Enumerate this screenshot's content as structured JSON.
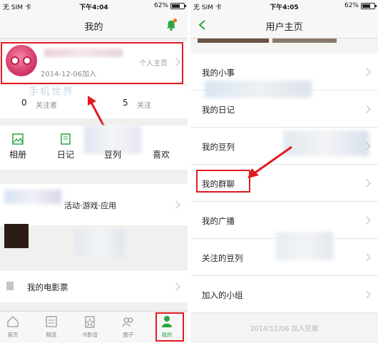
{
  "left": {
    "status": {
      "carrier": "无 SIM 卡",
      "time": "下午4:04",
      "battery": "62%"
    },
    "nav": {
      "title": "我的"
    },
    "profile": {
      "join_date": "2014-12-06加入",
      "homepage_link": "个人主页"
    },
    "watermark": "手机世界",
    "stats": {
      "followers_count": "0",
      "followers_label": "关注者",
      "following_count": "5",
      "following_label": "关注"
    },
    "grid": [
      "相册",
      "日记",
      "豆列",
      "喜欢"
    ],
    "activity_row": "活动·游戏·应用",
    "tickets_row": "我的电影票",
    "tabs": [
      {
        "label": "首页",
        "icon": "home-icon"
      },
      {
        "label": "精选",
        "icon": "featured-icon"
      },
      {
        "label": "书影音",
        "icon": "media-icon"
      },
      {
        "label": "圈子",
        "icon": "group-icon"
      },
      {
        "label": "我的",
        "icon": "user-icon"
      }
    ],
    "accent": "#2aa640",
    "highlight_color": "#e01c22"
  },
  "right": {
    "status": {
      "carrier": "无 SIM 卡",
      "time": "下午4:05",
      "battery": "62%"
    },
    "nav": {
      "title": "用户主页"
    },
    "items": [
      "我的小事",
      "我的日记",
      "我的豆列",
      "我的群聊",
      "我的广播",
      "关注的豆列",
      "加入的小组"
    ],
    "footer": "2014/12/06 加入豆瓣"
  }
}
